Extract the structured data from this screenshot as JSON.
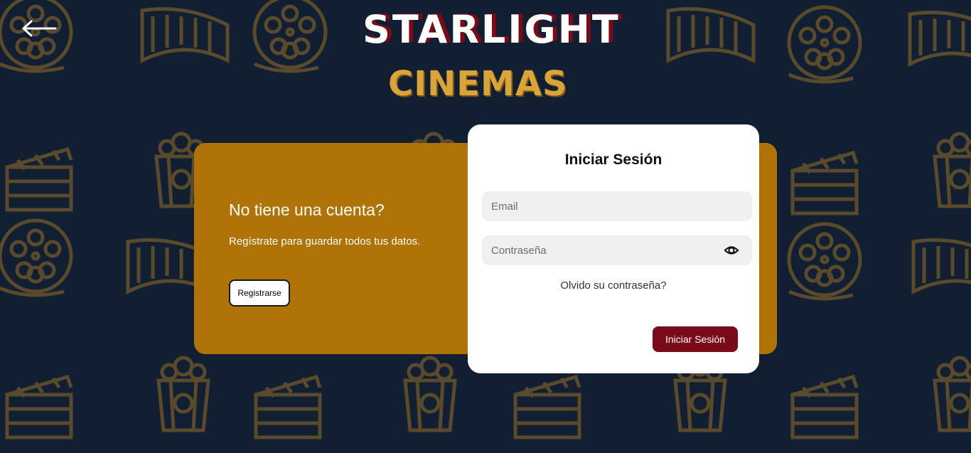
{
  "logo": {
    "line1": "STARLIGHT",
    "line2": "CINEMAS"
  },
  "left_panel": {
    "title": "No tiene una cuenta?",
    "text": "Regístrate para guardar todos tus datos.",
    "register_label": "Registrarse"
  },
  "login": {
    "title": "Iniciar Sesión",
    "email_placeholder": "Email",
    "password_placeholder": "Contraseña",
    "forgot_label": "Olvido su contraseña?",
    "submit_label": "Iniciar Sesión"
  },
  "icons": {
    "back": "arrow-left-icon",
    "eye": "eye-icon",
    "background": [
      "film-reel-icon",
      "film-strip-icon",
      "popcorn-icon",
      "clapperboard-icon"
    ]
  },
  "colors": {
    "background": "#121f33",
    "pattern": "#5a4a2c",
    "gold_panel": "#b07307",
    "card": "#ffffff",
    "brand_red": "#7b0a19",
    "input_bg": "#f0f0f0"
  }
}
